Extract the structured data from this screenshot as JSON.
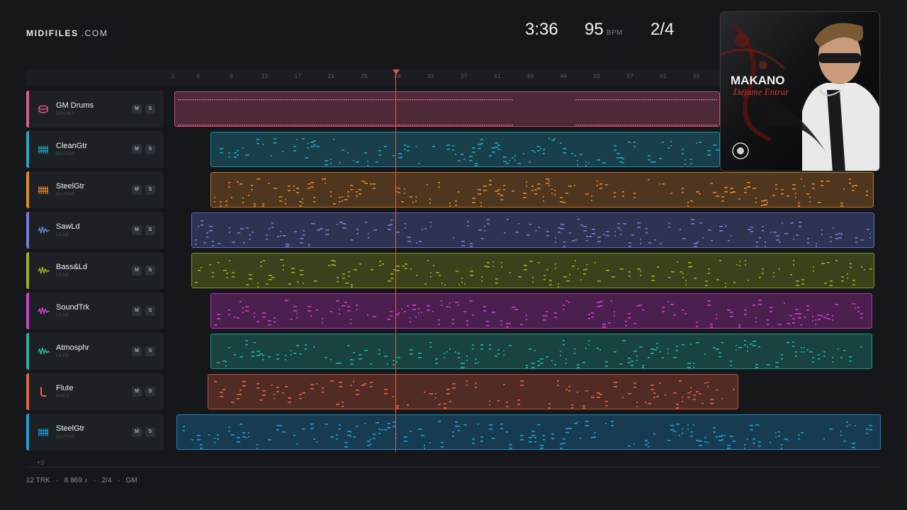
{
  "brand": {
    "name_bold": "MIDIFILES",
    "name_suffix": ".COM"
  },
  "header": {
    "duration": "3:36",
    "bpm": "95",
    "bpm_label": "BPM",
    "time_signature": "2/4"
  },
  "ruler": {
    "ticks": [
      "1",
      "5",
      "9",
      "13",
      "17",
      "21",
      "25",
      "29",
      "33",
      "37",
      "41",
      "45",
      "49",
      "53",
      "57",
      "61",
      "65"
    ]
  },
  "tracks": [
    {
      "name": "GM Drums",
      "category": "DRUMS",
      "icon": "drum-icon",
      "color": "#e45a8c",
      "mute": "M",
      "solo": "S"
    },
    {
      "name": "CleanGtr",
      "category": "GUITAR",
      "icon": "guitar-icon",
      "color": "#1fa8c6",
      "mute": "M",
      "solo": "S"
    },
    {
      "name": "SteelGtr",
      "category": "GUITAR",
      "icon": "guitar-icon",
      "color": "#e5892a",
      "mute": "M",
      "solo": "S"
    },
    {
      "name": "SawLd",
      "category": "LEAD",
      "icon": "wave-icon",
      "color": "#6f7fe0",
      "mute": "M",
      "solo": "S"
    },
    {
      "name": "Bass&Ld",
      "category": "LEAD",
      "icon": "wave-icon",
      "color": "#9bb21e",
      "mute": "M",
      "solo": "S"
    },
    {
      "name": "SoundTrk",
      "category": "LEAD",
      "icon": "wave-icon",
      "color": "#d63bd4",
      "mute": "M",
      "solo": "S"
    },
    {
      "name": "Atmosphr",
      "category": "LEAD",
      "icon": "wave-icon",
      "color": "#1fb8a0",
      "mute": "M",
      "solo": "S"
    },
    {
      "name": "Flute",
      "category": "REED",
      "icon": "flute-icon",
      "color": "#e8653f",
      "mute": "M",
      "solo": "S"
    },
    {
      "name": "SteelGtr",
      "category": "GUITAR",
      "icon": "guitar-icon",
      "color": "#1e9fe0",
      "mute": "M",
      "solo": "S"
    }
  ],
  "more_tracks": "+3",
  "footer": {
    "tracks": "12 TRK",
    "notes": "8 869 ♪",
    "time_signature": "2/4",
    "standard": "GM",
    "sep": "·"
  },
  "album": {
    "artist": "MAKANO",
    "title": "Déjame Entrar"
  }
}
